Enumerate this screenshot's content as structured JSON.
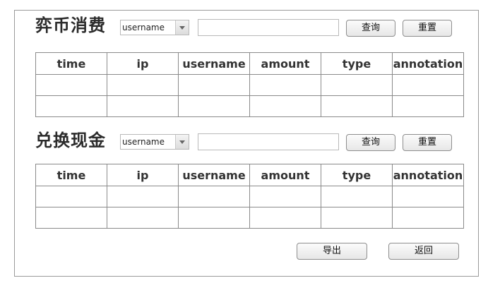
{
  "sections": [
    {
      "title": "弈币消费",
      "filter_value": "username",
      "query_label": "查询",
      "reset_label": "重置",
      "columns": [
        "time",
        "ip",
        "username",
        "amount",
        "type",
        "annotation"
      ]
    },
    {
      "title": "兑换现金",
      "filter_value": "username",
      "query_label": "查询",
      "reset_label": "重置",
      "columns": [
        "time",
        "ip",
        "username",
        "amount",
        "type",
        "annotation"
      ]
    }
  ],
  "footer": {
    "export_label": "导出",
    "back_label": "返回"
  }
}
